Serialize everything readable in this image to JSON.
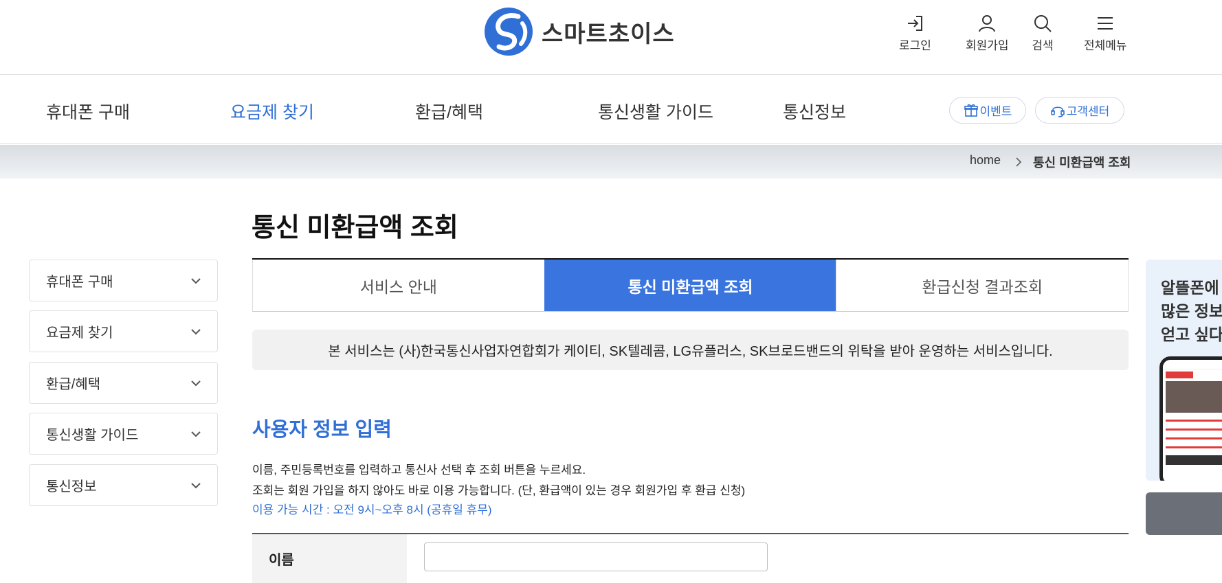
{
  "header": {
    "logo_text": "스마트초이스",
    "util": {
      "login": "로그인",
      "signup": "회원가입",
      "search": "검색",
      "menu": "전체메뉴"
    }
  },
  "gnb": {
    "items": [
      "휴대폰 구매",
      "요금제 찾기",
      "환급/혜택",
      "통신생활 가이드",
      "통신정보"
    ],
    "event": "이벤트",
    "support": "고객센터"
  },
  "breadcrumb": {
    "home": "home",
    "current": "통신 미환급액 조회"
  },
  "page_title": "통신 미환급액 조회",
  "side_menu": [
    "휴대폰 구매",
    "요금제 찾기",
    "환급/혜택",
    "통신생활 가이드",
    "통신정보"
  ],
  "tabs": [
    "서비스 안내",
    "통신 미환급액 조회",
    "환급신청 결과조회"
  ],
  "notice": "본 서비스는 (사)한국통신사업자연합회가 케이티, SK텔레콤, LG유플러스, SK브로드밴드의 위탁을 받아 운영하는 서비스입니다.",
  "section": {
    "title": "사용자 정보 입력",
    "desc1": "이름, 주민등록번호를 입력하고 통신사 선택 후 조회 버튼을 누르세요.",
    "desc2": "조회는 회원 가입을 하지 않아도 바로 이용 가능합니다. (단, 환급액이 있는 경우 회원가입 후 환급 신청)",
    "hours": "이용 가능 시간 : 오전 9시~오후 8시 (공휴일 휴무)"
  },
  "form": {
    "name_label": "이름",
    "name_value": ""
  },
  "banner": {
    "line1": "알뜰폰에",
    "line2": "많은 정보",
    "line3": "얻고 싶다"
  },
  "colors": {
    "accent": "#3a74df",
    "text_blue": "#2f6fd6"
  }
}
